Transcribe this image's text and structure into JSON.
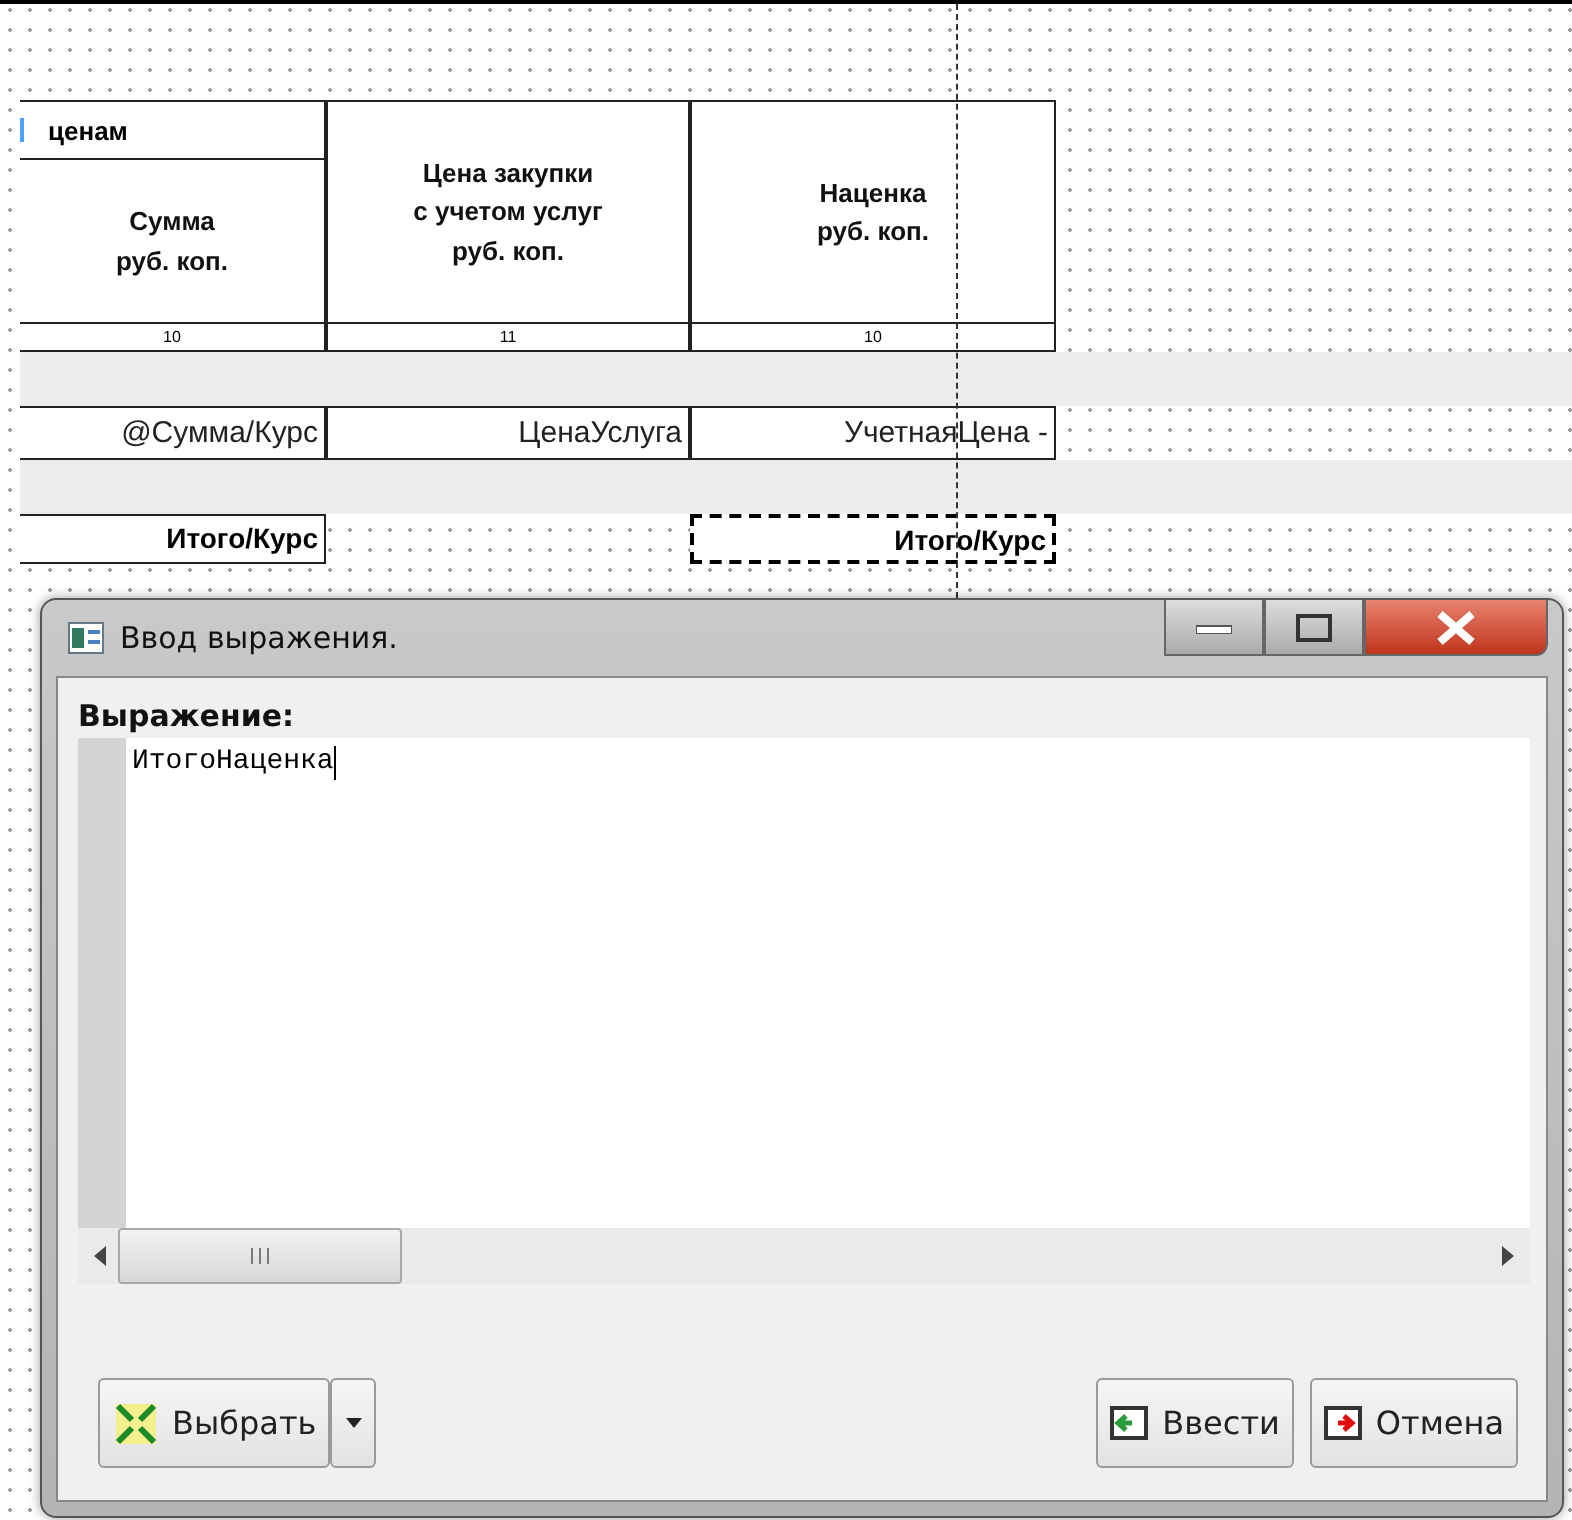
{
  "report": {
    "group_header": "ценам",
    "columns": [
      {
        "heading_lines": [
          "Сумма",
          "руб. коп."
        ],
        "number": "10",
        "detail": "@Сумма/Курс",
        "total": "Итого/Курс",
        "total_selected": false
      },
      {
        "heading_lines": [
          "Цена закупки",
          "с учетом услуг",
          "руб. коп."
        ],
        "number": "11",
        "detail": "ЦенаУслуга"
      },
      {
        "heading_lines": [
          "Наценка",
          "руб. коп."
        ],
        "number": "10",
        "detail": "УчетнаяЦена -",
        "total": "Итого/Курс",
        "total_selected": true
      }
    ]
  },
  "dialog": {
    "title": "Ввод выражения.",
    "label": "Выражение:",
    "expression": "ИтогоНаценка",
    "buttons": [
      {
        "kind": "split",
        "label": "Выбрать"
      },
      {
        "kind": "ok",
        "label": "Ввести"
      },
      {
        "kind": "cancel",
        "label": "Отмена"
      }
    ]
  }
}
